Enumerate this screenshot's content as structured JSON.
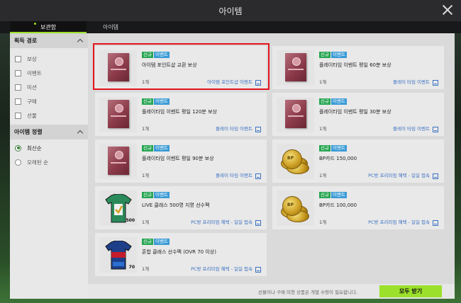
{
  "window": {
    "title": "아이템"
  },
  "tabs": [
    {
      "label": "보관함"
    },
    {
      "label": "아이템"
    }
  ],
  "sidebar": {
    "acquire_header": "획득 경로",
    "acquire_items": [
      {
        "label": "보상"
      },
      {
        "label": "이벤트"
      },
      {
        "label": "미션"
      },
      {
        "label": "구매"
      },
      {
        "label": "선물"
      }
    ],
    "sort_header": "아이템 정렬",
    "sort_options": [
      {
        "label": "최신순",
        "selected": true
      },
      {
        "label": "오래된 순",
        "selected": false
      }
    ]
  },
  "badges": {
    "new": "신규",
    "event": "이벤트"
  },
  "items": [
    {
      "title": "아이템 포인트샵 교환 보상",
      "qty": "1개",
      "source": "아이템 포인트샵 이벤트",
      "icon": "gift-box-icon"
    },
    {
      "title": "플레이타임 이벤트 평일 60분 보상",
      "qty": "1개",
      "source": "플레이 타임 이벤트",
      "icon": "gift-box-icon"
    },
    {
      "title": "플레이타임 이벤트 평일 120분 보상",
      "qty": "1개",
      "source": "플레이 타임 이벤트",
      "icon": "gift-box-icon"
    },
    {
      "title": "플레이타임 이벤트 평일 30분 보상",
      "qty": "1개",
      "source": "플레이 타임 이벤트",
      "icon": "gift-box-icon"
    },
    {
      "title": "플레이타임 이벤트 평일 90분 보상",
      "qty": "1개",
      "source": "플레이 타임 이벤트",
      "icon": "gift-box-icon"
    },
    {
      "title": "BP카드 150,000",
      "qty": "1개",
      "source": "PC방 프리미엄 혜택 - 일일 접속",
      "icon": "bp-coin-icon"
    },
    {
      "title": "LIVE 클래스 500명 지명 선수팩",
      "qty": "1개",
      "source": "PC방 프리미엄 혜택 - 일일 접속",
      "icon": "jersey-pack-icon",
      "thumb_text": "500"
    },
    {
      "title": "BP카드 100,000",
      "qty": "1개",
      "source": "PC방 프리미엄 혜택 - 일일 접속",
      "icon": "bp-coin-icon"
    },
    {
      "title": "혼합 클래스 선수팩 (OVR 70 이상)",
      "qty": "1개",
      "source": "PC방 프리미엄 혜택 - 일일 접속",
      "icon": "jersey-pack-icon",
      "thumb_text": "70"
    }
  ],
  "coin_label": "BP",
  "footer": {
    "notice": "선물이나 구매 미청 상품은 개별 수령이 필요합니다.",
    "button": "모두 받기"
  },
  "colors": {
    "accent": "#9be02a",
    "new_badge": "#28a653",
    "event_badge": "#3a9bd6",
    "link": "#3b71c2",
    "highlight": "#e4141c"
  }
}
